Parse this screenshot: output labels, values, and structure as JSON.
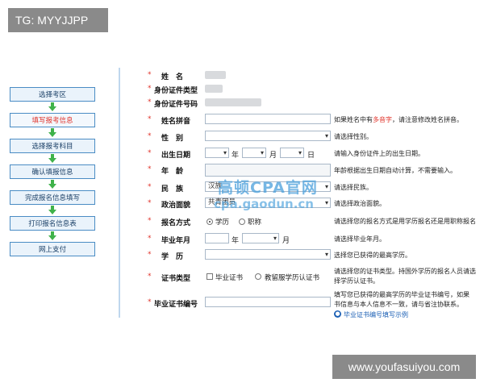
{
  "tag_label": "TG: MYYJJPP",
  "watermark": "www.youfasuiyou.com",
  "overlay": {
    "line1": "高顿CPA官网",
    "line2": "cpa.gaodun.cn"
  },
  "steps": [
    {
      "label": "选择考区",
      "active": false
    },
    {
      "label": "填写报考信息",
      "active": true
    },
    {
      "label": "选择报考科目",
      "active": false
    },
    {
      "label": "确认填报信息",
      "active": false
    },
    {
      "label": "完成报名信息填写",
      "active": false
    },
    {
      "label": "打印报名信息表",
      "active": false
    },
    {
      "label": "网上支付",
      "active": false
    }
  ],
  "form": {
    "name_label": "姓　名",
    "idtype_label": "身份证件类型",
    "idnum_label": "身份证件号码",
    "pinyin_label": "姓名拼音",
    "pinyin_hint_a": "如果姓名中有",
    "pinyin_hint_red": "多音字",
    "pinyin_hint_b": "，请注意修改姓名拼音。",
    "gender_label": "性　别",
    "gender_hint": "请选择性别。",
    "birth_label": "出生日期",
    "birth_year_unit": "年",
    "birth_month_unit": "月",
    "birth_day_unit": "日",
    "birth_hint": "请输入身份证件上的出生日期。",
    "age_label": "年　龄",
    "age_hint": "年龄根据出生日期自动计算，不需要输入。",
    "nation_label": "民　族",
    "nation_value": "汉族",
    "nation_hint": "请选择民族。",
    "politics_label": "政治面貌",
    "politics_value": "共青团员",
    "politics_hint": "请选择政治面貌。",
    "method_label": "报名方式",
    "method_opt1": "学历",
    "method_opt2": "职称",
    "method_hint": "请选择您的报名方式是用学历报名还是用职称报名",
    "grad_label": "毕业年月",
    "grad_year_unit": "年",
    "grad_month_unit": "月",
    "grad_hint": "请选择毕业年月。",
    "edu_label": "学　历",
    "edu_hint": "选择您已获得的最高学历。",
    "cert_label": "证书类型",
    "cert_opt1": "毕业证书",
    "cert_opt2": "教留服学历认证书",
    "cert_hint_1": "请选择您的证书类型。持国外学历的报名人员请选",
    "cert_hint_2": "择学历认证书。",
    "certnum_label": "毕业证书编号",
    "certnum_hint_1": "填写您已获得的最高学历的毕业证书编号，如果",
    "certnum_hint_2": "书信息与本人信息不一致，请与省注协联系。",
    "certnum_link": "毕业证书编号填写示例"
  }
}
